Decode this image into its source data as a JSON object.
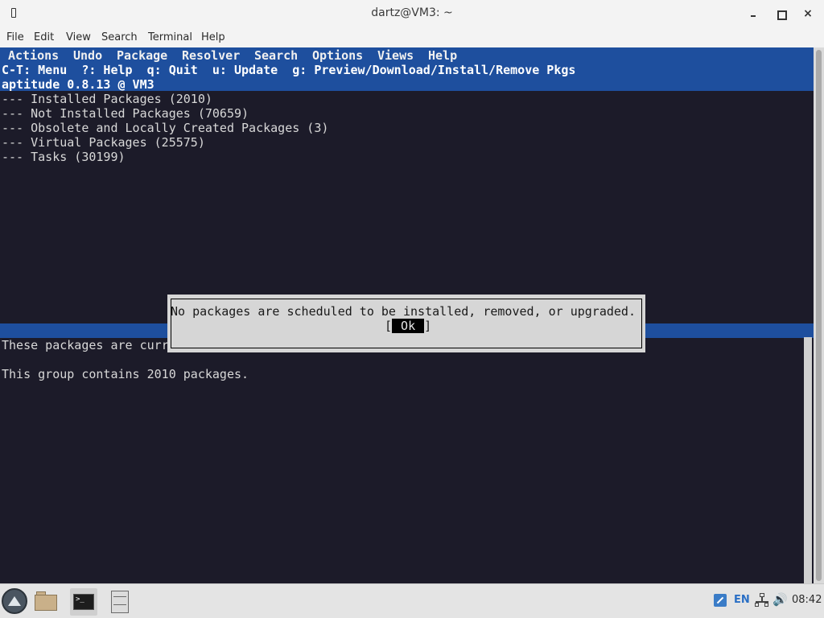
{
  "window": {
    "title": "dartz@VM3: ~",
    "close_glyph": "×"
  },
  "menubar": [
    "File",
    "Edit",
    "View",
    "Search",
    "Terminal",
    "Help"
  ],
  "aptitude": {
    "menu": [
      "Actions",
      "Undo",
      "Package",
      "Resolver",
      "Search",
      "Options",
      "Views",
      "Help"
    ],
    "keys_line": "C-T: Menu  ?: Help  q: Quit  u: Update  g: Preview/Download/Install/Remove Pkgs",
    "version_line": "aptitude 0.8.13 @ VM3",
    "groups": [
      "--- Installed Packages (2010)",
      "--- Not Installed Packages (70659)",
      "--- Obsolete and Locally Created Packages (3)",
      "--- Virtual Packages (25575)",
      "--- Tasks (30199)"
    ],
    "description_line": "These packages are curr",
    "group_count_line": "This group contains 2010 packages."
  },
  "dialog": {
    "message": "No packages are scheduled to be installed, removed, or upgraded.",
    "ok_open": "[",
    "ok_label": " Ok ",
    "ok_close": "]"
  },
  "taskbar": {
    "items": [
      "start-menu-icon",
      "file-manager-icon",
      "terminal-icon",
      "file-cabinet-icon"
    ],
    "terminal_prompt": ">_",
    "language": "EN",
    "volume_glyph": "🔊",
    "clock": "08:42"
  },
  "colors": {
    "terminal_bg": "#1c1b29",
    "aptitude_blue": "#1e4f9e",
    "dialog_bg": "#d6d6d6"
  }
}
